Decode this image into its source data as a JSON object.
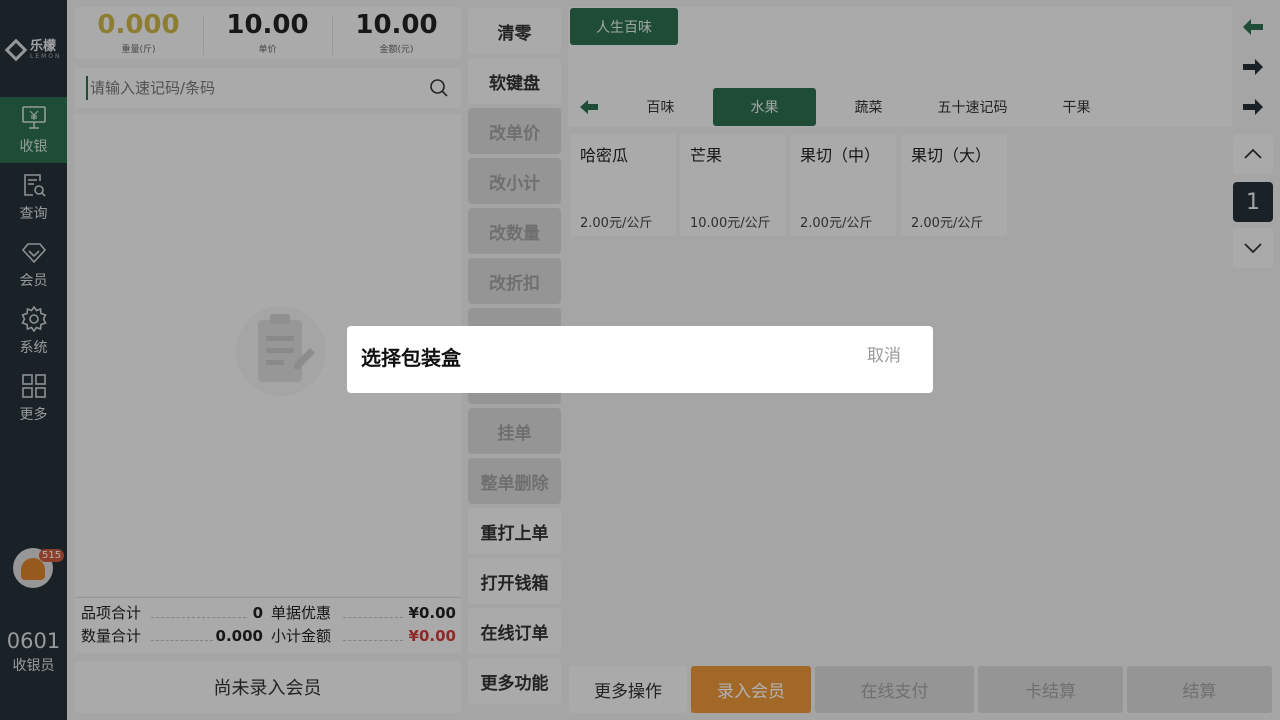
{
  "nav": {
    "logo_cn": "乐檬",
    "logo_en": "LEMON",
    "items": [
      {
        "label": "收银",
        "icon": "cashier-register-icon"
      },
      {
        "label": "查询",
        "icon": "search-document-icon"
      },
      {
        "label": "会员",
        "icon": "diamond-icon"
      },
      {
        "label": "系统",
        "icon": "gear-icon"
      },
      {
        "label": "更多",
        "icon": "grid-icon"
      }
    ],
    "badge": "515",
    "cashier_no": "0601",
    "cashier_label": "收银员"
  },
  "summary": {
    "weight": {
      "value": "0.000",
      "label": "重量(斤)"
    },
    "price": {
      "value": "10.00",
      "label": "单价"
    },
    "amount": {
      "value": "10.00",
      "label": "金额(元)"
    }
  },
  "search": {
    "placeholder": "请输入速记码/条码"
  },
  "totals": {
    "items_label": "品项合计",
    "items_value": "0",
    "discount_label": "单据优惠",
    "discount_value": "¥0.00",
    "qty_label": "数量合计",
    "qty_value": "0.000",
    "subtotal_label": "小计金额",
    "subtotal_value": "¥0.00"
  },
  "member_bar": "尚未录入会员",
  "functions": {
    "clear": "清零",
    "soft_keyboard": "软键盘",
    "change_price": "改单价",
    "change_subtotal": "改小计",
    "change_qty": "改数量",
    "change_discount": "改折扣",
    "hold": "挂单",
    "delete_all": "整单删除",
    "reprint": "重打上单",
    "open_drawer": "打开钱箱",
    "online_order": "在线订单",
    "more_functions": "更多功能"
  },
  "store_button": "人生百味",
  "categories": [
    "百味",
    "水果",
    "蔬菜",
    "五十速记码",
    "干果"
  ],
  "active_category": "水果",
  "products": [
    {
      "name": "哈密瓜",
      "price": "2.00元/公斤"
    },
    {
      "name": "芒果",
      "price": "10.00元/公斤"
    },
    {
      "name": "果切（中）",
      "price": "2.00元/公斤"
    },
    {
      "name": "果切（大）",
      "price": "2.00元/公斤"
    }
  ],
  "page": "1",
  "bottom": {
    "more_ops": "更多操作",
    "enter_member": "录入会员",
    "online_pay": "在线支付",
    "card_checkout": "卡结算",
    "checkout": "结算"
  },
  "colors": {
    "brand": "#2d6d4f",
    "nav_bg": "#26323a",
    "member_btn": "#e8953a",
    "weight": "#c9b44a",
    "red": "#d03a3a"
  },
  "modal": {
    "title": "选择包装盒",
    "cancel": "取消"
  }
}
